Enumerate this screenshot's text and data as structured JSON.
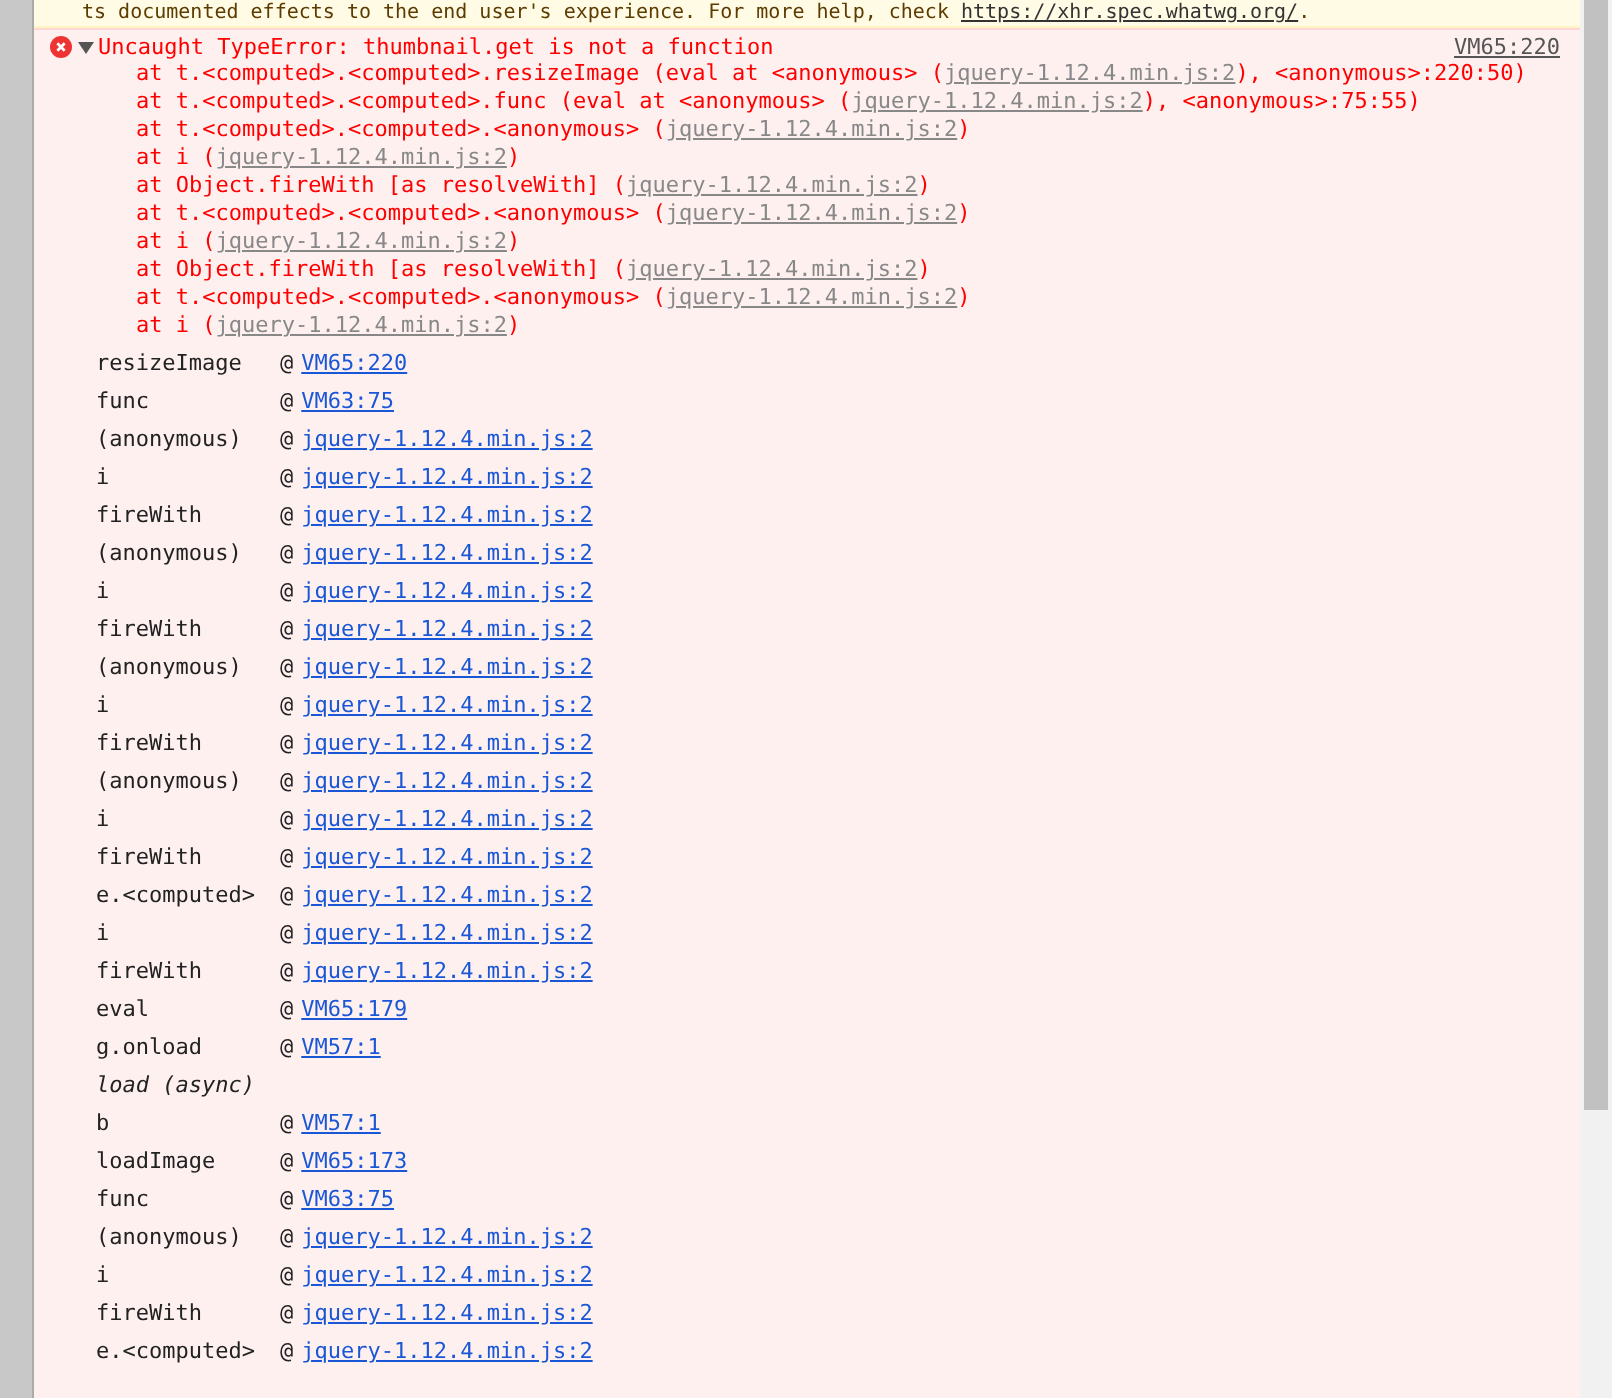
{
  "warning": {
    "text": "ts documented effects to the end user's experience. For more help, check ",
    "link": "https://xhr.spec.whatwg.org/",
    "after": "."
  },
  "error": {
    "expanded": true,
    "message": "Uncaught TypeError: thumbnail.get is not a function",
    "source": "VM65:220",
    "stack": [
      {
        "prefix": "at t.<computed>.<computed>.resizeImage (eval at <anonymous> (",
        "link": "jquery-1.12.4.min.js:2",
        "suffix": "), <anonymous>:220:50)"
      },
      {
        "prefix": "at t.<computed>.<computed>.func (eval at <anonymous> (",
        "link": "jquery-1.12.4.min.js:2",
        "suffix": "), <anonymous>:75:55)"
      },
      {
        "prefix": "at t.<computed>.<computed>.<anonymous> (",
        "link": "jquery-1.12.4.min.js:2",
        "suffix": ")"
      },
      {
        "prefix": "at i (",
        "link": "jquery-1.12.4.min.js:2",
        "suffix": ")"
      },
      {
        "prefix": "at Object.fireWith [as resolveWith] (",
        "link": "jquery-1.12.4.min.js:2",
        "suffix": ")"
      },
      {
        "prefix": "at t.<computed>.<computed>.<anonymous> (",
        "link": "jquery-1.12.4.min.js:2",
        "suffix": ")"
      },
      {
        "prefix": "at i (",
        "link": "jquery-1.12.4.min.js:2",
        "suffix": ")"
      },
      {
        "prefix": "at Object.fireWith [as resolveWith] (",
        "link": "jquery-1.12.4.min.js:2",
        "suffix": ")"
      },
      {
        "prefix": "at t.<computed>.<computed>.<anonymous> (",
        "link": "jquery-1.12.4.min.js:2",
        "suffix": ")"
      },
      {
        "prefix": "at i (",
        "link": "jquery-1.12.4.min.js:2",
        "suffix": ")"
      }
    ]
  },
  "frames": [
    {
      "kind": "frame",
      "name": "resizeImage",
      "at": "@",
      "link": "VM65:220"
    },
    {
      "kind": "frame",
      "name": "func",
      "at": "@",
      "link": "VM63:75"
    },
    {
      "kind": "frame",
      "name": "(anonymous)",
      "at": "@",
      "link": "jquery-1.12.4.min.js:2"
    },
    {
      "kind": "frame",
      "name": "i",
      "at": "@",
      "link": "jquery-1.12.4.min.js:2"
    },
    {
      "kind": "frame",
      "name": "fireWith",
      "at": "@",
      "link": "jquery-1.12.4.min.js:2"
    },
    {
      "kind": "frame",
      "name": "(anonymous)",
      "at": "@",
      "link": "jquery-1.12.4.min.js:2"
    },
    {
      "kind": "frame",
      "name": "i",
      "at": "@",
      "link": "jquery-1.12.4.min.js:2"
    },
    {
      "kind": "frame",
      "name": "fireWith",
      "at": "@",
      "link": "jquery-1.12.4.min.js:2"
    },
    {
      "kind": "frame",
      "name": "(anonymous)",
      "at": "@",
      "link": "jquery-1.12.4.min.js:2"
    },
    {
      "kind": "frame",
      "name": "i",
      "at": "@",
      "link": "jquery-1.12.4.min.js:2"
    },
    {
      "kind": "frame",
      "name": "fireWith",
      "at": "@",
      "link": "jquery-1.12.4.min.js:2"
    },
    {
      "kind": "frame",
      "name": "(anonymous)",
      "at": "@",
      "link": "jquery-1.12.4.min.js:2"
    },
    {
      "kind": "frame",
      "name": "i",
      "at": "@",
      "link": "jquery-1.12.4.min.js:2"
    },
    {
      "kind": "frame",
      "name": "fireWith",
      "at": "@",
      "link": "jquery-1.12.4.min.js:2"
    },
    {
      "kind": "frame",
      "name": "e.<computed>",
      "at": "@",
      "link": "jquery-1.12.4.min.js:2"
    },
    {
      "kind": "frame",
      "name": "i",
      "at": "@",
      "link": "jquery-1.12.4.min.js:2"
    },
    {
      "kind": "frame",
      "name": "fireWith",
      "at": "@",
      "link": "jquery-1.12.4.min.js:2"
    },
    {
      "kind": "frame",
      "name": "eval",
      "at": "@",
      "link": "VM65:179"
    },
    {
      "kind": "frame",
      "name": "g.onload",
      "at": "@",
      "link": "VM57:1"
    },
    {
      "kind": "async",
      "name": "load (async)"
    },
    {
      "kind": "frame",
      "name": "b",
      "at": "@",
      "link": "VM57:1"
    },
    {
      "kind": "frame",
      "name": "loadImage",
      "at": "@",
      "link": "VM65:173"
    },
    {
      "kind": "frame",
      "name": "func",
      "at": "@",
      "link": "VM63:75"
    },
    {
      "kind": "frame",
      "name": "(anonymous)",
      "at": "@",
      "link": "jquery-1.12.4.min.js:2"
    },
    {
      "kind": "frame",
      "name": "i",
      "at": "@",
      "link": "jquery-1.12.4.min.js:2"
    },
    {
      "kind": "frame",
      "name": "fireWith",
      "at": "@",
      "link": "jquery-1.12.4.min.js:2"
    },
    {
      "kind": "frame",
      "name": "e.<computed>",
      "at": "@",
      "link": "jquery-1.12.4.min.js:2"
    }
  ]
}
